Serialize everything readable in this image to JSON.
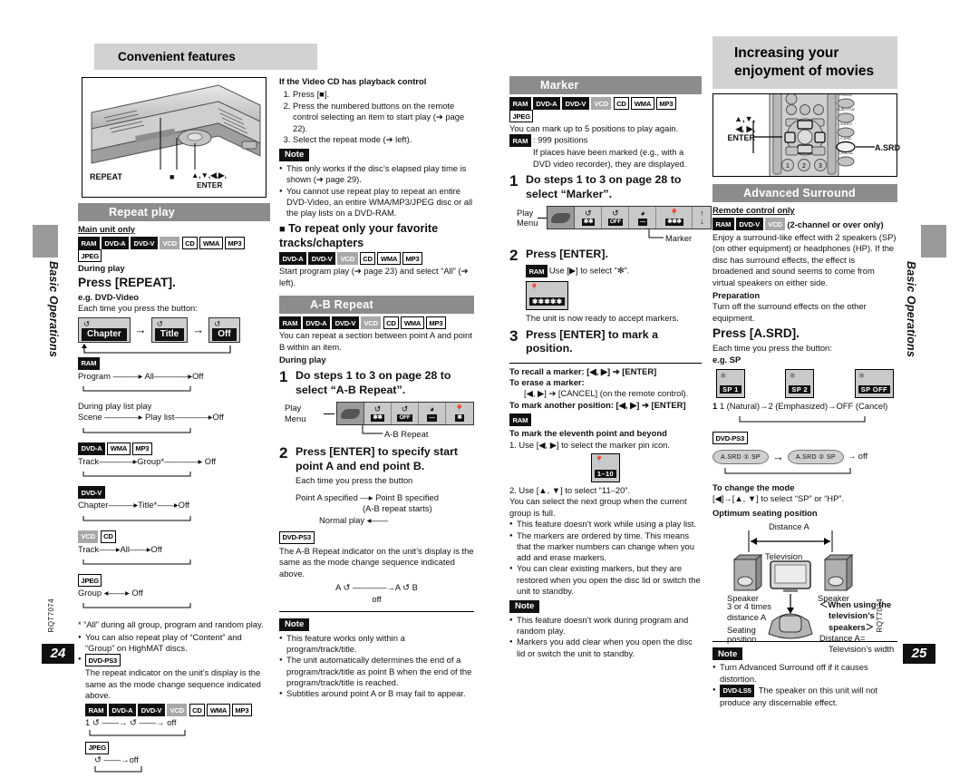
{
  "left_page": {
    "title": "Convenient features",
    "page_number": "24",
    "doc_code": "RQT7074",
    "side_tab_label": "Basic Operations",
    "illustration": {
      "name": "main-unit-top-panel",
      "callout_repeat": "REPEAT",
      "callout_stop": "■",
      "callout_cursor": "▲,▼,◀,▶,",
      "callout_enter": "ENTER"
    },
    "repeat_play": {
      "heading": "Repeat play",
      "main_unit_only": "Main unit only",
      "badges": [
        {
          "label": "RAM",
          "style": "black"
        },
        {
          "label": "DVD-A",
          "style": "black"
        },
        {
          "label": "DVD-V",
          "style": "black"
        },
        {
          "label": "VCD",
          "style": "gray"
        },
        {
          "label": "CD",
          "style": "white"
        },
        {
          "label": "WMA",
          "style": "white"
        },
        {
          "label": "MP3",
          "style": "white"
        },
        {
          "label": "JPEG",
          "style": "white"
        }
      ],
      "during_play": "During play",
      "instruction": "Press [REPEAT].",
      "example": "e.g. DVD-Video",
      "each_time": "Each time you press the button:",
      "cycle_chips": [
        {
          "label": "Chapter"
        },
        {
          "label": "Title"
        },
        {
          "label": "Off"
        }
      ],
      "modes": [
        {
          "badges": [
            {
              "label": "RAM",
              "style": "black"
            }
          ],
          "sub": "",
          "sequence": "Program ———▸ All————▸Off"
        },
        {
          "badges": [],
          "sub": "During play list play",
          "sequence": "Scene ————▸ Play list————▸Off"
        },
        {
          "badges": [
            {
              "label": "DVD-A",
              "style": "black"
            },
            {
              "label": "WMA",
              "style": "white"
            },
            {
              "label": "MP3",
              "style": "white"
            }
          ],
          "sub": "",
          "sequence": "Track————▸Group*————▸ Off"
        },
        {
          "badges": [
            {
              "label": "DVD-V",
              "style": "black"
            }
          ],
          "sub": "",
          "sequence": "Chapter———▸Title*——▸Off"
        },
        {
          "badges": [
            {
              "label": "VCD",
              "style": "gray"
            },
            {
              "label": "CD",
              "style": "white"
            }
          ],
          "sub": "",
          "sequence": "Track——▸All——▸Off"
        },
        {
          "badges": [
            {
              "label": "JPEG",
              "style": "white"
            }
          ],
          "sub": "",
          "sequence": "Group ◂——▸ Off"
        }
      ],
      "footnote": "* “All” during all group, program and random play.",
      "bullets": [
        "You can also repeat play of “Content” and “Group” on HighMAT discs."
      ],
      "ps3_badge": "DVD-PS3",
      "ps3_text": "The repeat indicator on the unit’s display is the same as the mode change sequence indicated above.",
      "ps3_badges": [
        {
          "label": "RAM",
          "style": "black"
        },
        {
          "label": "DVD-A",
          "style": "black"
        },
        {
          "label": "DVD-V",
          "style": "black"
        },
        {
          "label": "VCD",
          "style": "gray"
        },
        {
          "label": "CD",
          "style": "white"
        },
        {
          "label": "WMA",
          "style": "white"
        },
        {
          "label": "MP3",
          "style": "white"
        }
      ],
      "ps3_seq1": "1 ↺ ——→ ↺ ——→ off",
      "ps3_jpeg_badge": "JPEG",
      "ps3_seq2": "↺ ——→off"
    },
    "video_cd_pbc": {
      "heading": "If the Video CD has playback control",
      "steps": [
        "Press [■].",
        "Press the numbered buttons on the remote control selecting an item to start play (➔ page 22).",
        "Select the repeat mode (➔ left)."
      ],
      "note_label": "Note",
      "note_bullets": [
        "This only works if the disc’s elapsed play time is shown (➔ page 29).",
        "You cannot use repeat play to repeat an entire DVD-Video, an entire WMA/MP3/JPEG disc or all the play lists on a DVD-RAM."
      ],
      "subsection_heading": "To repeat only your favorite tracks/chapters",
      "subsection_badges": [
        {
          "label": "DVD-A",
          "style": "black"
        },
        {
          "label": "DVD-V",
          "style": "black"
        },
        {
          "label": "VCD",
          "style": "gray"
        },
        {
          "label": "CD",
          "style": "white"
        },
        {
          "label": "WMA",
          "style": "white"
        },
        {
          "label": "MP3",
          "style": "white"
        }
      ],
      "subsection_text": "Start program play (➔ page 23) and select “All” (➔ left)."
    },
    "ab_repeat": {
      "heading": "A-B Repeat",
      "badges": [
        {
          "label": "RAM",
          "style": "black"
        },
        {
          "label": "DVD-A",
          "style": "black"
        },
        {
          "label": "DVD-V",
          "style": "black"
        },
        {
          "label": "VCD",
          "style": "gray"
        },
        {
          "label": "CD",
          "style": "white"
        },
        {
          "label": "WMA",
          "style": "white"
        },
        {
          "label": "MP3",
          "style": "white"
        }
      ],
      "intro": "You can repeat a section between point A and point B within an item.",
      "during_play": "During play",
      "step1_no": "1",
      "step1": "Do steps 1 to 3 on page 28 to select “A-B Repeat”.",
      "play_menu_label": "Play Menu",
      "play_menu_caption": "A-B Repeat",
      "step2_no": "2",
      "step2": "Press [ENTER] to specify start point A and end point B.",
      "step2_sub": "Each time you press the button",
      "flow_line1": "Point A specified —▸ Point B specified",
      "flow_line2": "(A-B repeat starts)",
      "flow_line3": "Normal play ◂——",
      "ps3_badge": "DVD-PS3",
      "ps3_text": "The A-B Repeat indicator on the unit’s display is the same as the mode change sequence indicated above.",
      "ps3_seq": "A ↺ ————→A ↺ B",
      "ps3_seq_off": "off",
      "note_label": "Note",
      "note_bullets": [
        "This feature works only within a program/track/title.",
        "The unit automatically determines the end of a program/track/title as point B when the end of the program/track/title is reached.",
        "Subtitles around point A or B may fail to appear."
      ]
    },
    "marker": {
      "heading": "Marker",
      "badges": [
        {
          "label": "RAM",
          "style": "black"
        },
        {
          "label": "DVD-A",
          "style": "black"
        },
        {
          "label": "DVD-V",
          "style": "black"
        },
        {
          "label": "VCD",
          "style": "gray"
        },
        {
          "label": "CD",
          "style": "white"
        },
        {
          "label": "WMA",
          "style": "white"
        },
        {
          "label": "MP3",
          "style": "white"
        },
        {
          "label": "JPEG",
          "style": "white"
        }
      ],
      "intro": "You can mark up to 5 positions to play again.",
      "ram_badge": "RAM",
      "ram_text": ": 999 positions",
      "ram_sub": "If places have been marked (e.g., with a DVD video recorder), they are displayed.",
      "step1_no": "1",
      "step1": "Do steps 1 to 3 on page 28 to select “Marker”.",
      "play_label_1": "Play",
      "play_label_2": "Menu",
      "marker_caption": "Marker",
      "step2_no": "2",
      "step2": "Press [ENTER].",
      "step2_sub_badge": "RAM",
      "step2_sub": "Use [▶] to select “✻”.",
      "ready_text": "The unit is now ready to accept markers.",
      "step3_no": "3",
      "step3": "Press [ENTER] to mark a position.",
      "recall": "To recall a marker:  [◀, ▶] ➔ [ENTER]",
      "erase": "To erase a marker:",
      "erase_sub": "[◀, ▶] ➔ [CANCEL] (on the remote control).",
      "mark_another": "To mark another position:  [◀, ▶] ➔ [ENTER]",
      "eleventh_badge": "RAM",
      "eleventh_heading": "To mark the eleventh point and beyond",
      "eleventh_step1": "1.  Use [◀, ▶] to select the marker pin icon.",
      "pin_display": "1–10",
      "eleventh_step2": "2.  Use [▲, ▼] to select “11–20”.",
      "eleventh_text": "You can select the next group when the current group is full.",
      "bullets": [
        "This feature doesn’t work while using a play list.",
        "The markers are ordered by time. This means that the marker numbers can change when you add and erase markers.",
        "You can clear existing markers, but they are restored when you open the disc lid or switch the unit to standby."
      ],
      "note_label": "Note",
      "note_bullets": [
        "This feature doesn’t work during program and random play.",
        "Markers you add clear when you open the disc lid or switch the unit to standby."
      ]
    }
  },
  "right_page": {
    "title_line1": "Increasing your",
    "title_line2": "enjoyment of movies",
    "page_number": "25",
    "doc_code": "RQT7074",
    "side_tab_label": "Basic Operations",
    "illustration": {
      "name": "remote-control",
      "callout_cursor_line1": "▲,▼,",
      "callout_cursor_line2": "◀, ▶,",
      "callout_enter": "ENTER",
      "callout_asrd": "A.SRD",
      "keys_row_labels": [
        "ANGLE",
        "SUBTITLE",
        "AUDIO",
        "A.SRD",
        "CANCEL"
      ],
      "numbered_keys": [
        "1",
        "2",
        "3"
      ]
    },
    "advanced_surround": {
      "heading": "Advanced Surround",
      "remote_only": "Remote control only",
      "badges": [
        {
          "label": "RAM",
          "style": "black"
        },
        {
          "label": "DVD-V",
          "style": "black"
        },
        {
          "label": "VCD",
          "style": "gray"
        }
      ],
      "badge_suffix": "(2-channel or over only)",
      "intro": "Enjoy a surround-like effect with 2 speakers (SP) (on other equipment) or headphones (HP). If the disc has surround effects, the effect is broadened and sound seems to come from virtual speakers on either side.",
      "preparation_heading": "Preparation",
      "preparation_text": "Turn off the surround effects on the other equipment.",
      "instruction": "Press [A.SRD].",
      "each_time": "Each time you press the button:",
      "example": "e.g. SP",
      "sp_chips": [
        {
          "label": "SP  1"
        },
        {
          "label": "SP  2"
        },
        {
          "label": "SP OFF"
        }
      ],
      "sequence": "1 (Natural)→2 (Emphasized)→OFF (Cancel)",
      "ps3_badge": "DVD-PS3",
      "ps3_chip1": "A.SRD ① SP",
      "ps3_chip2": "A.SRD ② SP",
      "ps3_off": "→ off",
      "change_mode_heading": "To change the mode",
      "change_mode_text": "[◀]→[▲, ▼] to select “SP” or “HP”.",
      "seating_heading": "Optimum seating position",
      "diagram": {
        "distance_label": "Distance A",
        "television_label": "Television",
        "speaker_left": "Speaker",
        "speaker_right": "Speaker",
        "vertical_label_1": "3 or 4 times",
        "vertical_label_2": "distance A",
        "seating_1": "Seating",
        "seating_2": "position",
        "tv_note_1": "＜When using the",
        "tv_note_2": "television’s",
        "tv_note_3": "speakers＞",
        "tv_note_4": "Distance A=",
        "tv_note_5": "Television’s width"
      },
      "note_label": "Note",
      "note_bullets": [
        "Turn Advanced Surround off if it causes distortion."
      ],
      "note_badge": "DVD-LS5",
      "note_badge_text": "The speaker on this unit will not produce any discernable effect."
    }
  }
}
